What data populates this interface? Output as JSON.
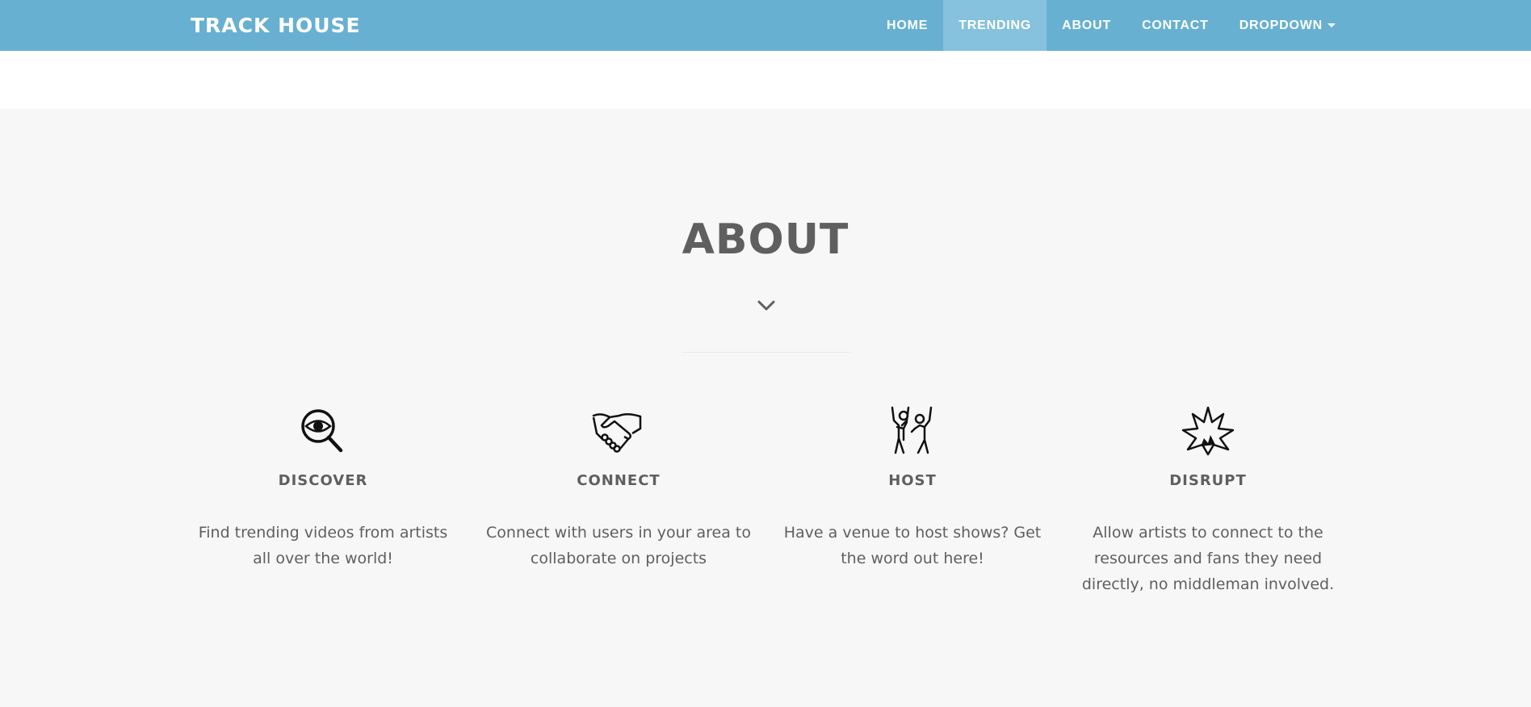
{
  "navbar": {
    "brand": "TRACK HOUSE",
    "items": [
      {
        "label": "HOME"
      },
      {
        "label": "TRENDING",
        "active": true
      },
      {
        "label": "ABOUT"
      },
      {
        "label": "CONTACT"
      },
      {
        "label": "DROPDOWN",
        "has_caret": true
      }
    ],
    "bg_color": "#67b0d2",
    "active_color": "#86c1dd"
  },
  "about": {
    "title": "ABOUT",
    "features": [
      {
        "icon": "magnifier-eye-icon",
        "title": "DISCOVER",
        "text": "Find trending videos from artists all over the world!"
      },
      {
        "icon": "handshake-icon",
        "title": "CONNECT",
        "text": "Connect with users in your area to collaborate on projects"
      },
      {
        "icon": "dancing-people-icon",
        "title": "HOST",
        "text": "Have a venue to host shows? Get the word out here!"
      },
      {
        "icon": "explosion-icon",
        "title": "DISRUPT",
        "text": "Allow artists to connect to the resources and fans they need directly, no middleman involved."
      }
    ]
  }
}
